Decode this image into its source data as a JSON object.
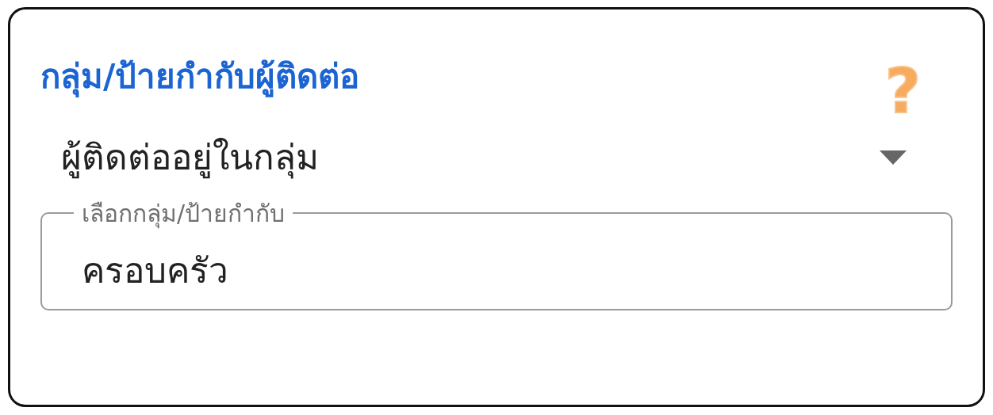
{
  "title": "กลุ่ม/ป้ายกำกับผู้ติดต่อ",
  "help": {
    "glyph": "?"
  },
  "dropdown": {
    "value": "ผู้ติดต่ออยู่ในกลุ่ม"
  },
  "field": {
    "label": "เลือกกลุ่ม/ป้ายกำกับ",
    "value": "ครอบครัว"
  }
}
